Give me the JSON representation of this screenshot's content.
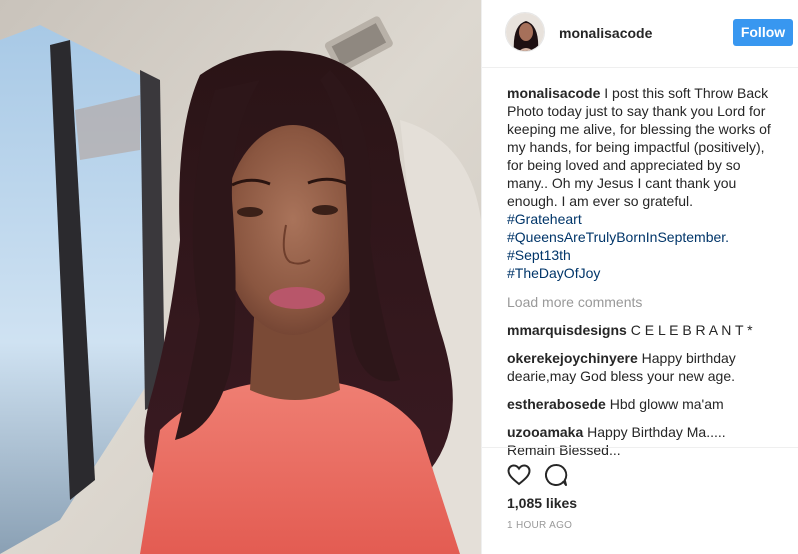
{
  "post": {
    "username": "monalisacode",
    "follow_label": "Follow",
    "caption": {
      "user": "monalisacode",
      "text": "I post this soft Throw Back Photo today just to say thank you Lord for keeping me alive, for blessing the works of my hands, for being impactful (positively), for being loved and appreciated by so many.. Oh my Jesus I cant thank you enough. I am ever so grateful.",
      "hashtags": [
        "#Grateheart",
        "#QueensAreTrulyBornInSeptember.",
        "#Sept13th",
        "#TheDayOfJoy"
      ]
    },
    "load_more": "Load more comments",
    "comments": [
      {
        "user": "mmarquisdesigns",
        "text": "C E L E B R A N T *"
      },
      {
        "user": "okerekejoychinyere",
        "text": "Happy birthday dearie,may God bless your new age."
      },
      {
        "user": "estherabosede",
        "text": "Hbd gloww ma'am"
      },
      {
        "user": "uzooamaka",
        "text": "Happy Birthday Ma..... Remain Blessed..."
      }
    ],
    "likes": "1,085 likes",
    "timestamp": "1 HOUR AGO",
    "icons": {
      "like": "heart-icon",
      "comment": "comment-bubble-icon"
    },
    "colors": {
      "follow": "#3897f0",
      "hashtag": "#003569",
      "muted": "#999999"
    }
  }
}
